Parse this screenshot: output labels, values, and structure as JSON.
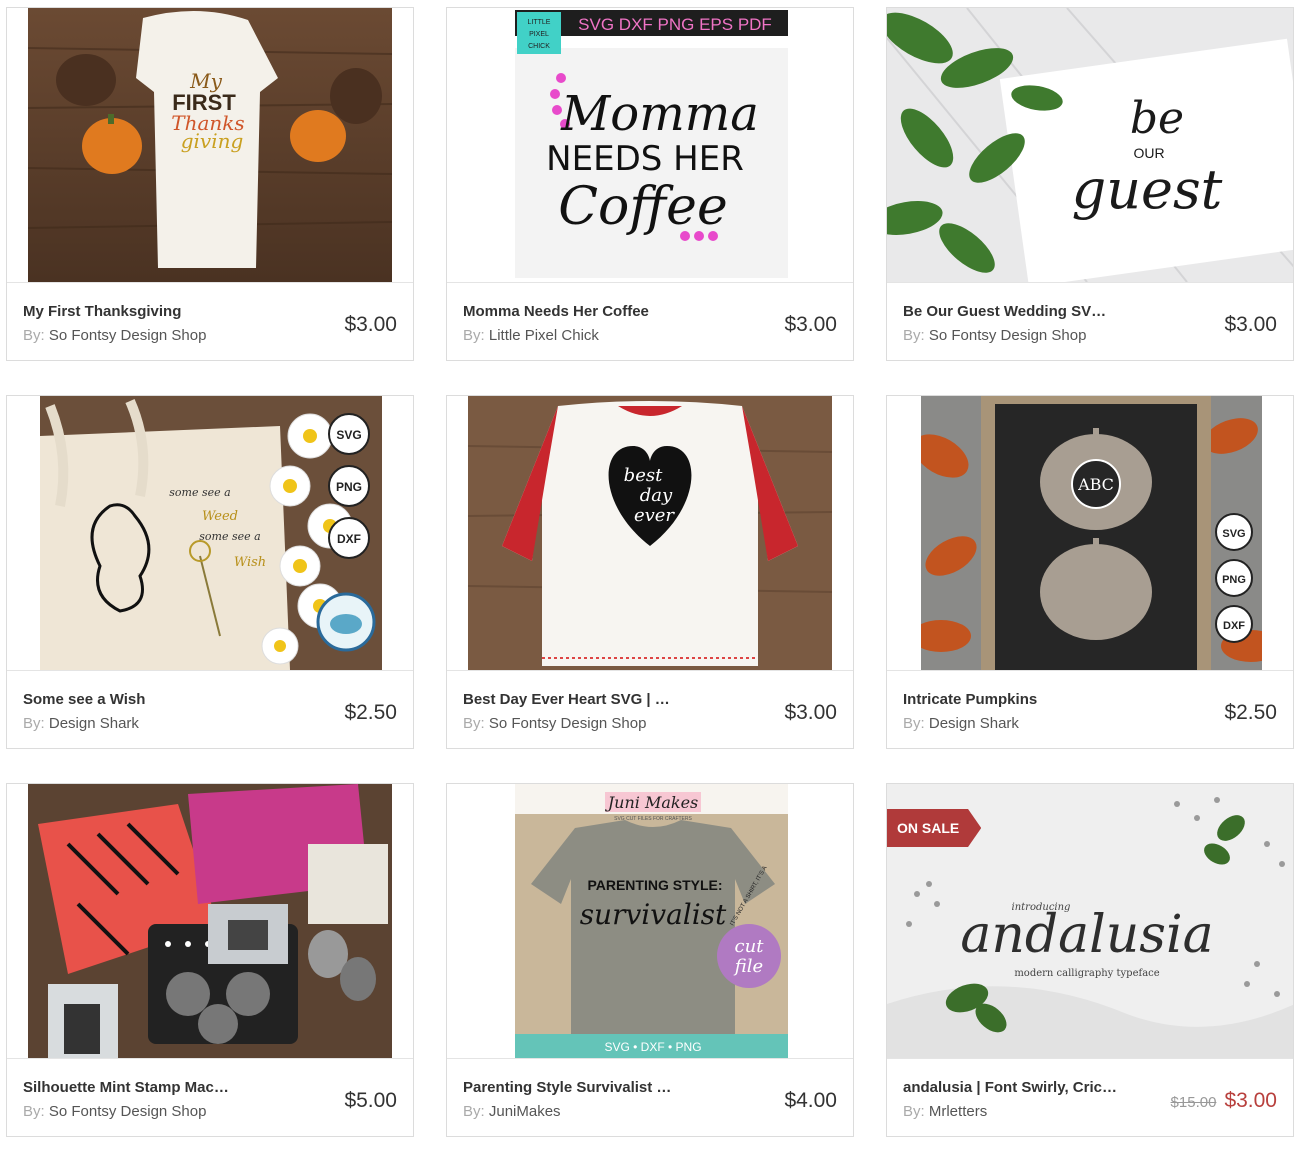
{
  "products": [
    {
      "title": "My First Thanksgiving",
      "by_label": "By:",
      "author": "So Fontsy Design Shop",
      "price": "$3.00",
      "image_text": [
        "My",
        "FIRST",
        "Thanks",
        "giving"
      ]
    },
    {
      "title": "Momma Needs Her Coffee",
      "by_label": "By:",
      "author": "Little Pixel Chick",
      "price": "$3.00",
      "image_text": [
        "SVG DXF PNG EPS PDF",
        "Momma",
        "NEEDS HER",
        "Coffee",
        "LITTLE",
        "PIXEL",
        "CHICK"
      ]
    },
    {
      "title": "Be Our Guest Wedding SV…",
      "by_label": "By:",
      "author": "So Fontsy Design Shop",
      "price": "$3.00",
      "image_text": [
        "be",
        "OUR",
        "guest"
      ]
    },
    {
      "title": "Some see a Wish",
      "by_label": "By:",
      "author": "Design Shark",
      "price": "$2.50",
      "image_text": [
        "some see a",
        "Weed",
        "some see a",
        "Wish",
        "SVG",
        "PNG",
        "DXF"
      ]
    },
    {
      "title": "Best Day Ever Heart SVG | …",
      "by_label": "By:",
      "author": "So Fontsy Design Shop",
      "price": "$3.00",
      "image_text": [
        "best",
        "day",
        "ever"
      ]
    },
    {
      "title": "Intricate Pumpkins",
      "by_label": "By:",
      "author": "Design Shark",
      "price": "$2.50",
      "image_text": [
        "ABC",
        "SVG",
        "PNG",
        "DXF"
      ]
    },
    {
      "title": "Silhouette Mint Stamp Mac…",
      "by_label": "By:",
      "author": "So Fontsy Design Shop",
      "price": "$5.00",
      "image_text": []
    },
    {
      "title": "Parenting Style Survivalist …",
      "by_label": "By:",
      "author": "JuniMakes",
      "price": "$4.00",
      "image_text": [
        "Juni Makes",
        "SVG CUT FILES FOR CRAFTERS",
        "PARENTING STYLE:",
        "survivalist",
        "cut",
        "file",
        "IT'S NOT A SHIRT, IT'S A",
        "SVG • DXF • PNG"
      ]
    },
    {
      "title": "andalusia | Font Swirly, Cric…",
      "by_label": "By:",
      "author": "Mrletters",
      "price_old": "$15.00",
      "price": "$3.00",
      "badge": "ON SALE",
      "image_text": [
        "introducing",
        "andalusia",
        "modern calligraphy typeface"
      ]
    }
  ],
  "colors": {
    "sale_red": "#b8403d",
    "badge_red": "#b03a3a",
    "border": "#dcdcdc",
    "text": "#333333",
    "muted": "#aaaaaa"
  }
}
